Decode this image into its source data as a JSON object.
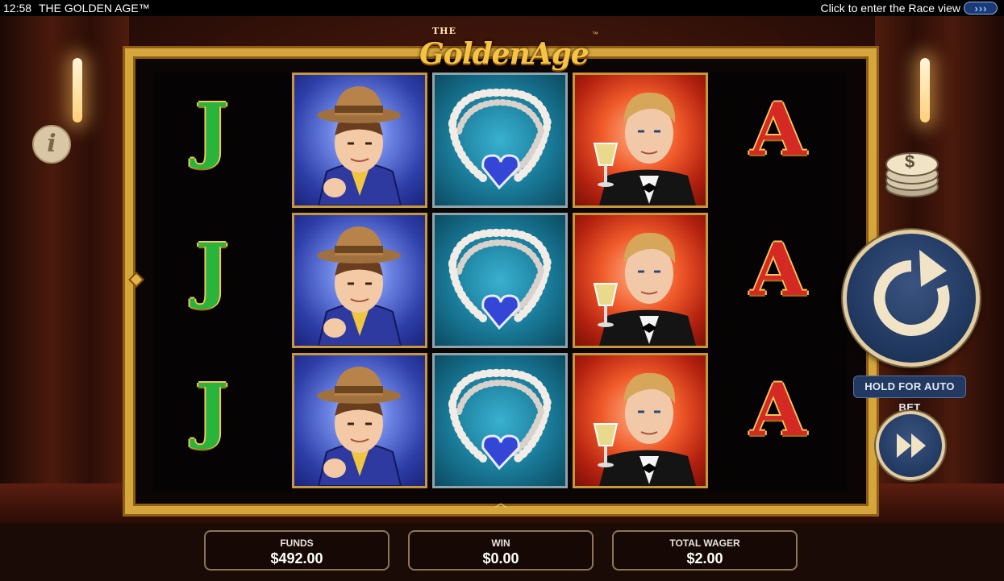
{
  "topbar": {
    "time": "12:58",
    "title": "THE GOLDEN AGE™",
    "race_link": "Click to enter the Race view"
  },
  "logo": {
    "the": "THE",
    "main": "GoldenAge",
    "tm": "™"
  },
  "reels": {
    "left_column": [
      "J",
      "J",
      "J"
    ],
    "right_column": [
      "A",
      "A",
      "A"
    ],
    "column_2": [
      "gentleman-in-hat",
      "gentleman-in-hat",
      "gentleman-in-hat"
    ],
    "column_3": [
      "pearl-necklace-blue-heart",
      "pearl-necklace-blue-heart",
      "pearl-necklace-blue-heart"
    ],
    "column_4": [
      "gentleman-with-champagne",
      "gentleman-with-champagne",
      "gentleman-with-champagne"
    ]
  },
  "controls": {
    "info_glyph": "i",
    "coin_glyph": "$",
    "autobet_label": "HOLD FOR AUTO BET"
  },
  "meters": {
    "funds_label": "FUNDS",
    "funds_value": "$492.00",
    "win_label": "WIN",
    "win_value": "$0.00",
    "wager_label": "TOTAL WAGER",
    "wager_value": "$2.00"
  },
  "colors": {
    "frame_gold": "#d5a63b",
    "spin_blue": "#223a62",
    "letter_j": "#2bb43b",
    "letter_a": "#d52a24"
  }
}
